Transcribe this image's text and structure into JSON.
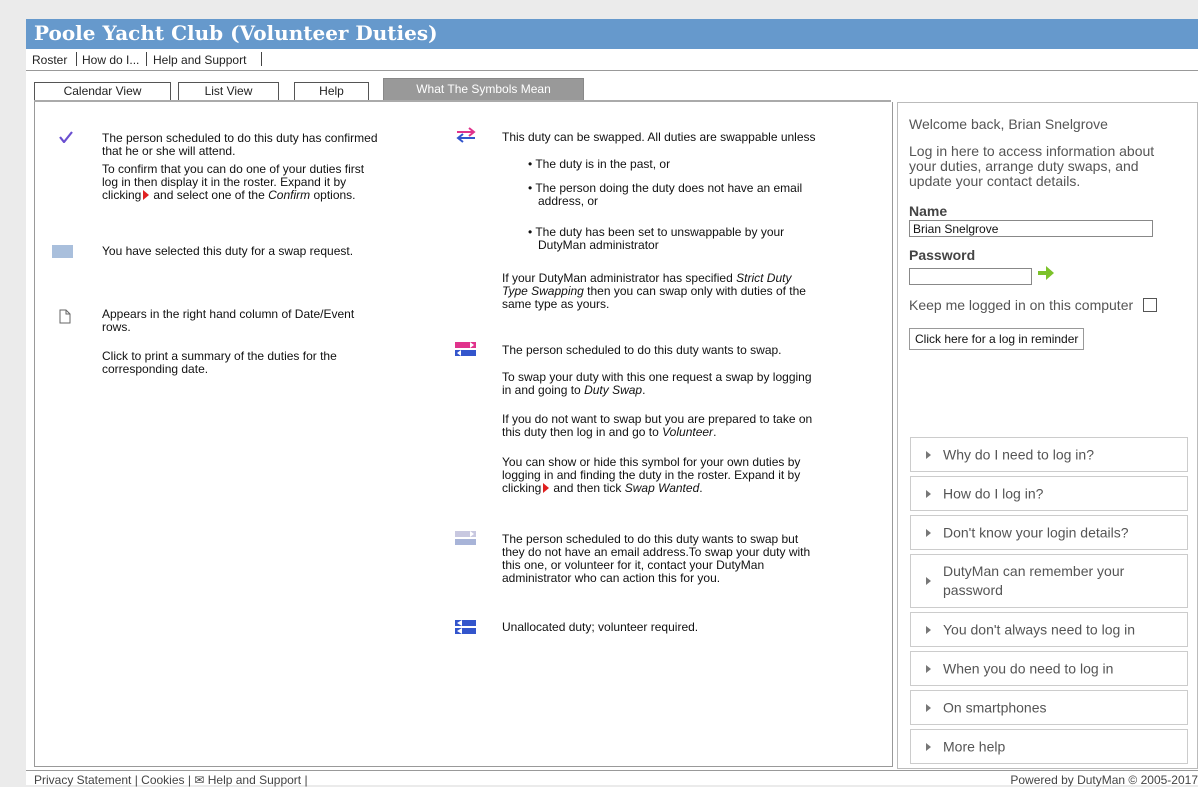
{
  "header": {
    "title": "Poole Yacht Club (Volunteer Duties)"
  },
  "topnav": {
    "roster": "Roster",
    "how_do_i": "How do I...",
    "help_support": "Help and Support"
  },
  "tabs": [
    "Calendar View",
    "List View",
    "Help",
    "What The Symbols Mean"
  ],
  "symbols": {
    "confirmed": {
      "line1": "The person scheduled to do this duty has confirmed",
      "line2": "that he or she will attend.",
      "p2a": "To confirm that you can do one of your duties first",
      "p2b": "log in then display it in the roster. Expand it by",
      "p2c_pre": "clicking",
      "p2c_mid": "and select one of the",
      "p2c_em": "Confirm",
      "p2c_post": "options."
    },
    "selected": {
      "text": "You have selected this duty for a swap request."
    },
    "print": {
      "line1": "Appears in the right hand column of Date/Event",
      "line2": "rows.",
      "p2a": "Click to print a summary of the duties for the",
      "p2b": "corresponding date."
    },
    "swappable": {
      "intro": "This duty can be swapped. All duties are swappable unless",
      "b1": "The duty is in the past, or",
      "b2a": "The person doing the duty does not have an email",
      "b2b": "address, or",
      "b3a": "The duty has been set to unswappable by your",
      "b3b": "DutyMan administrator",
      "s1": "If your DutyMan administrator has specified",
      "s1_em": "Strict Duty",
      "s2_em": "Type Swapping",
      "s2": "then you can swap only with duties of the",
      "s3": "same type as yours."
    },
    "wants_swap": {
      "p1": "The person scheduled to do this duty wants to swap.",
      "p2a": "To swap your duty with this one request a swap by logging",
      "p2b": "in and going to",
      "p2b_em": "Duty Swap",
      "p3a": "If you do not want to swap but you are prepared to take on",
      "p3b": "this duty then log in and go to",
      "p3b_em": "Volunteer",
      "p4a": "You can show or hide this symbol for your own duties by",
      "p4b": "logging in and finding the duty in the roster. Expand it by",
      "p4c_pre": "clicking",
      "p4c_mid": "and then tick",
      "p4c_em": "Swap Wanted"
    },
    "no_email": {
      "l1": "The person scheduled to do this duty wants to swap but",
      "l2": "they do not have an email address.To swap your duty with",
      "l3": "this one, or volunteer for it, contact your DutyMan",
      "l4": "administrator who can action this for you."
    },
    "unallocated": {
      "text": "Unallocated duty; volunteer required."
    }
  },
  "sidebar": {
    "welcome": "Welcome back, Brian Snelgrove",
    "intro1": "Log in here to access information about",
    "intro2": "your duties, arrange duty swaps, and",
    "intro3": "update your contact details.",
    "name_label": "Name",
    "name_value": "Brian Snelgrove",
    "password_label": "Password",
    "password_value": "",
    "keep_logged": "Keep me logged in on this computer",
    "reminder_button": "Click here for a log in reminder",
    "help_items": [
      "Why do I need to log in?",
      "How do I log in?",
      "Don't know your login details?",
      "DutyMan can remember your password",
      "You don't always need to log in",
      "When you do need to log in",
      "On smartphones",
      "More help"
    ]
  },
  "footer": {
    "privacy": "Privacy Statement",
    "cookies": "Cookies",
    "help": "Help and Support",
    "powered": "Powered by DutyMan © 2005-2017"
  },
  "colors": {
    "banner": "#6699cc",
    "confirm_tick": "#6a4fd0",
    "swap_pink": "#e0338c",
    "swap_blue": "#3355cc",
    "go_arrow": "#7cc22a",
    "caret_red": "#e02020"
  }
}
